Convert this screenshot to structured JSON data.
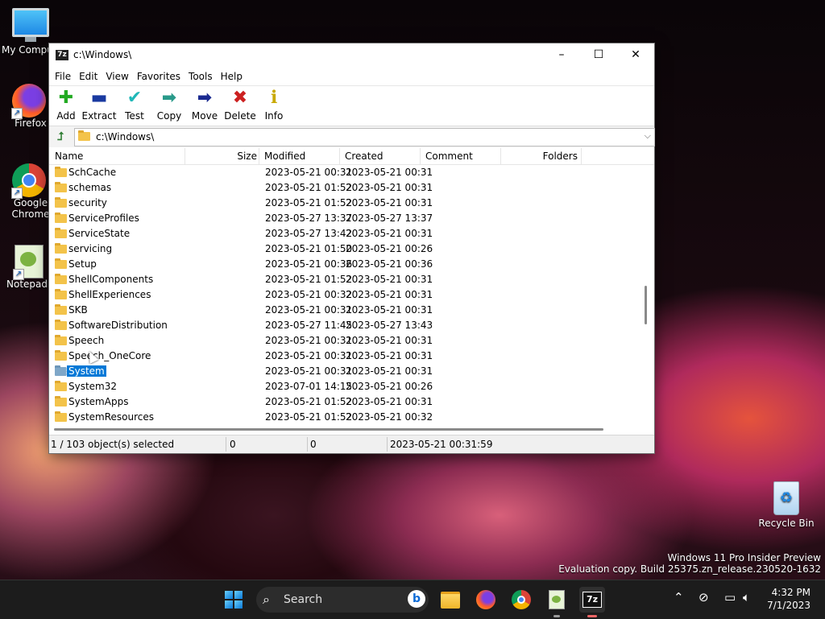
{
  "desktop": {
    "icons": [
      {
        "label": "My Compu",
        "icon": "computer-icon"
      },
      {
        "label": "Firefox",
        "icon": "firefox-icon"
      },
      {
        "label": "Google Chrome",
        "icon": "chrome-icon"
      },
      {
        "label": "Notepad+",
        "icon": "notepad-plus-plus-icon"
      },
      {
        "label": "Recycle Bin",
        "icon": "recycle-bin-icon"
      }
    ],
    "watermark": {
      "line1": "Windows 11 Pro Insider Preview",
      "line2": "Evaluation copy. Build 25375.zn_release.230520-1632"
    }
  },
  "window": {
    "title": "c:\\Windows\\",
    "app_icon_text": "7z",
    "controls": {
      "minimize": "–",
      "maximize": "☐",
      "close": "✕"
    },
    "menu": [
      "File",
      "Edit",
      "View",
      "Favorites",
      "Tools",
      "Help"
    ],
    "toolbar": [
      {
        "label": "Add",
        "icon": "plus-icon",
        "color": "#22aa22",
        "glyph": "✚"
      },
      {
        "label": "Extract",
        "icon": "minus-icon",
        "color": "#1a3aa0",
        "glyph": "▬"
      },
      {
        "label": "Test",
        "icon": "check-icon",
        "color": "#20b8b8",
        "glyph": "✔"
      },
      {
        "label": "Copy",
        "icon": "arrow-right-copy-icon",
        "color": "#2a9a8a",
        "glyph": "➡"
      },
      {
        "label": "Move",
        "icon": "arrow-right-move-icon",
        "color": "#1a2a90",
        "glyph": "➡"
      },
      {
        "label": "Delete",
        "icon": "x-icon",
        "color": "#cc2020",
        "glyph": "✖"
      },
      {
        "label": "Info",
        "icon": "info-icon",
        "color": "#c8a800",
        "glyph": "ℹ"
      }
    ],
    "address": "c:\\Windows\\",
    "columns": [
      "Name",
      "Size",
      "Modified",
      "Created",
      "Comment",
      "Folders"
    ],
    "rows": [
      {
        "name": "SchCache",
        "modified": "2023-05-21 00:31",
        "created": "2023-05-21 00:31"
      },
      {
        "name": "schemas",
        "modified": "2023-05-21 01:52",
        "created": "2023-05-21 00:31"
      },
      {
        "name": "security",
        "modified": "2023-05-21 01:52",
        "created": "2023-05-21 00:31"
      },
      {
        "name": "ServiceProfiles",
        "modified": "2023-05-27 13:37",
        "created": "2023-05-27 13:37"
      },
      {
        "name": "ServiceState",
        "modified": "2023-05-27 13:42",
        "created": "2023-05-21 00:31"
      },
      {
        "name": "servicing",
        "modified": "2023-05-21 01:50",
        "created": "2023-05-21 00:26"
      },
      {
        "name": "Setup",
        "modified": "2023-05-21 00:36",
        "created": "2023-05-21 00:36"
      },
      {
        "name": "ShellComponents",
        "modified": "2023-05-21 01:52",
        "created": "2023-05-21 00:31"
      },
      {
        "name": "ShellExperiences",
        "modified": "2023-05-21 00:32",
        "created": "2023-05-21 00:31"
      },
      {
        "name": "SKB",
        "modified": "2023-05-21 00:31",
        "created": "2023-05-21 00:31"
      },
      {
        "name": "SoftwareDistribution",
        "modified": "2023-05-27 11:45",
        "created": "2023-05-27 13:43"
      },
      {
        "name": "Speech",
        "modified": "2023-05-21 00:31",
        "created": "2023-05-21 00:31"
      },
      {
        "name": "Speech_OneCore",
        "modified": "2023-05-21 00:31",
        "created": "2023-05-21 00:31"
      },
      {
        "name": "System",
        "modified": "2023-05-21 00:31",
        "created": "2023-05-21 00:31",
        "selected": true
      },
      {
        "name": "System32",
        "modified": "2023-07-01 14:15",
        "created": "2023-05-21 00:26"
      },
      {
        "name": "SystemApps",
        "modified": "2023-05-21 01:52",
        "created": "2023-05-21 00:31"
      },
      {
        "name": "SystemResources",
        "modified": "2023-05-21 01:52",
        "created": "2023-05-21 00:32"
      }
    ],
    "status": {
      "selection": "1 / 103 object(s) selected",
      "size": "0",
      "packed": "0",
      "date": "2023-05-21 00:31:59"
    }
  },
  "taskbar": {
    "search_label": "Search",
    "apps": [
      "start-icon",
      "file-explorer-icon",
      "firefox-icon",
      "chrome-icon",
      "notepad-plus-plus-icon",
      "7zip-icon"
    ],
    "time": "4:32 PM",
    "date": "7/1/2023"
  }
}
